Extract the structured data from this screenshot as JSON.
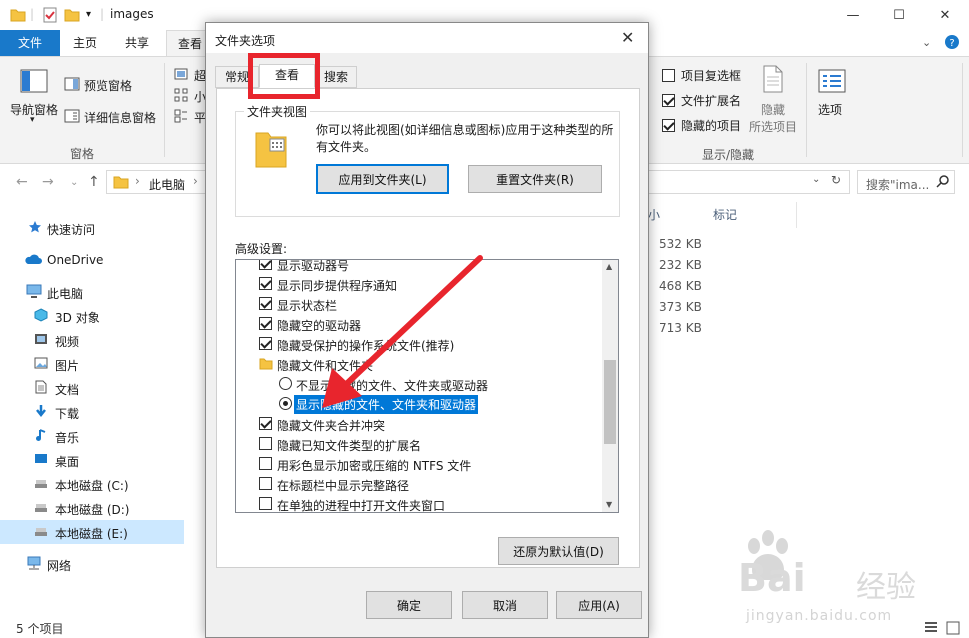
{
  "window": {
    "title": "images",
    "controls": {
      "minimize": "—",
      "maximize": "☐",
      "close": "✕"
    }
  },
  "ribbon": {
    "tabs": [
      "文件",
      "主页",
      "共享",
      "查看"
    ],
    "nav_pane_label": "导航窗格",
    "preview_pane_label": "预览窗格",
    "details_pane_label": "详细信息窗格",
    "pane_group_label": "窗格",
    "layout_items": [
      "超",
      "小",
      "平"
    ],
    "item_checkboxes_label": "项目复选框",
    "file_extensions_label": "文件扩展名",
    "hidden_items_label": "隐藏的项目",
    "hide_selected_label": "隐藏",
    "hide_selected_label2": "所选项目",
    "show_hide_group_label": "显示/隐藏",
    "options_label": "选项",
    "checkbox_states": {
      "item_checkboxes": false,
      "file_extensions": true,
      "hidden_items": true
    }
  },
  "address": {
    "path_root": "此电脑",
    "search_placeholder": "搜索\"ima..."
  },
  "nav": {
    "items": [
      "快速访问",
      "OneDrive",
      "此电脑",
      "3D 对象",
      "视频",
      "图片",
      "文档",
      "下载",
      "音乐",
      "桌面",
      "本地磁盘 (C:)",
      "本地磁盘 (D:)",
      "本地磁盘 (E:)",
      "网络"
    ]
  },
  "files": {
    "col_size": "小",
    "col_tags": "标记",
    "sizes": [
      "532 KB",
      "232 KB",
      "468 KB",
      "373 KB",
      "713 KB"
    ]
  },
  "status": {
    "count": "5 个项目"
  },
  "dialog": {
    "title": "文件夹选项",
    "tabs": [
      "常规",
      "查看",
      "搜索"
    ],
    "folder_views_group": "文件夹视图",
    "folder_views_desc_1": "你可以将此视图(如详细信息或图标)应用于这种类型的所",
    "folder_views_desc_2": "有文件夹。",
    "apply_to_folders": "应用到文件夹(L)",
    "reset_folders": "重置文件夹(R)",
    "advanced_label": "高级设置:",
    "advanced_items": [
      {
        "kind": "check",
        "checked": true,
        "label": "显示驱动器号"
      },
      {
        "kind": "check",
        "checked": true,
        "label": "显示同步提供程序通知"
      },
      {
        "kind": "check",
        "checked": true,
        "label": "显示状态栏"
      },
      {
        "kind": "check",
        "checked": true,
        "label": "隐藏空的驱动器"
      },
      {
        "kind": "check",
        "checked": true,
        "label": "隐藏受保护的操作系统文件(推荐)"
      },
      {
        "kind": "folder",
        "label": "隐藏文件和文件夹"
      },
      {
        "kind": "radio",
        "checked": false,
        "label": "不显示隐藏的文件、文件夹或驱动器"
      },
      {
        "kind": "radio",
        "checked": true,
        "label": "显示隐藏的文件、文件夹和驱动器"
      },
      {
        "kind": "check",
        "checked": true,
        "label": "隐藏文件夹合并冲突"
      },
      {
        "kind": "check",
        "checked": false,
        "label": "隐藏已知文件类型的扩展名"
      },
      {
        "kind": "check",
        "checked": false,
        "label": "用彩色显示加密或压缩的 NTFS 文件"
      },
      {
        "kind": "check",
        "checked": false,
        "label": "在标题栏中显示完整路径"
      },
      {
        "kind": "check",
        "checked": false,
        "label": "在单独的进程中打开文件夹窗口"
      }
    ],
    "restore_defaults": "还原为默认值(D)",
    "ok": "确定",
    "cancel": "取消",
    "apply": "应用(A)"
  },
  "watermark": {
    "brand_prefix": "Bai",
    "brand_suffix": "经验",
    "url": "jingyan.baidu.com"
  },
  "colors": {
    "accent": "#0078d7",
    "file_tab": "#1979ca",
    "annotation_red": "#e8252d"
  }
}
